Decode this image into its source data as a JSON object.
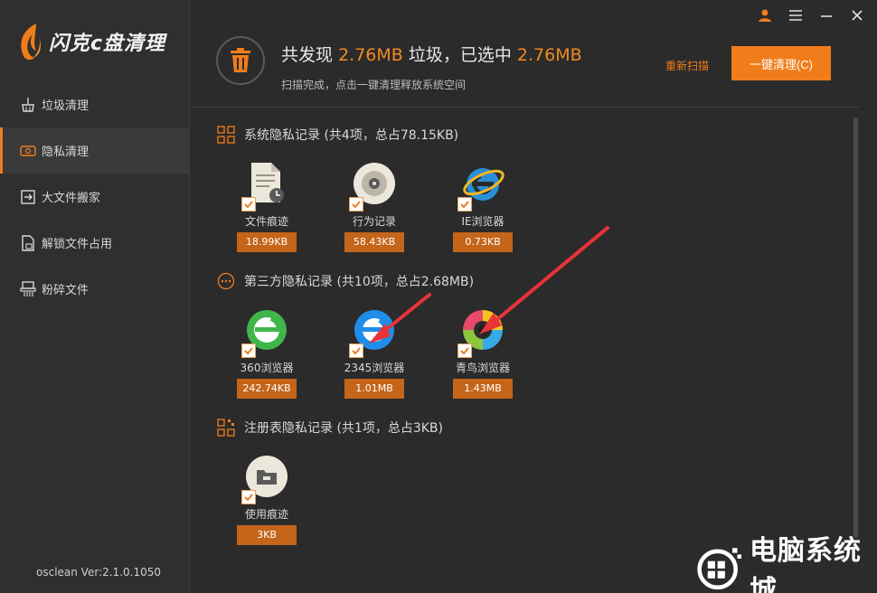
{
  "app": {
    "brand": "闪克c盘清理",
    "version": "osclean Ver:2.1.0.1050"
  },
  "sidebar": {
    "items": [
      {
        "label": "垃圾清理",
        "icon": "broom-icon",
        "active": false
      },
      {
        "label": "隐私清理",
        "icon": "privacy-icon",
        "active": true
      },
      {
        "label": "大文件搬家",
        "icon": "move-icon",
        "active": false
      },
      {
        "label": "解锁文件占用",
        "icon": "unlock-file-icon",
        "active": false
      },
      {
        "label": "粉碎文件",
        "icon": "shredder-icon",
        "active": false
      }
    ]
  },
  "header": {
    "summary_prefix": "共发现",
    "found_size": "2.76MB",
    "summary_mid": "垃圾，已选中",
    "selected_size": "2.76MB",
    "subtitle": "扫描完成，点击一键清理释放系统空间",
    "rescan_label": "重新扫描",
    "clean_label": "一键清理(C)"
  },
  "sections": [
    {
      "title": "系统隐私记录 (共4项，总占78.15KB)",
      "items": [
        {
          "label": "文件痕迹",
          "size": "18.99KB",
          "icon": "file-trace-icon"
        },
        {
          "label": "行为记录",
          "size": "58.43KB",
          "icon": "disc-record-icon"
        },
        {
          "label": "IE浏览器",
          "size": "0.73KB",
          "icon": "ie-browser-icon"
        }
      ]
    },
    {
      "title": "第三方隐私记录 (共10项，总占2.68MB)",
      "items": [
        {
          "label": "360浏览器",
          "size": "242.74KB",
          "icon": "360-browser-icon"
        },
        {
          "label": "2345浏览器",
          "size": "1.01MB",
          "icon": "2345-browser-icon"
        },
        {
          "label": "青鸟浏览器",
          "size": "1.43MB",
          "icon": "qingniao-browser-icon"
        }
      ]
    },
    {
      "title": "注册表隐私记录 (共1项，总占3KB)",
      "items": [
        {
          "label": "使用痕迹",
          "size": "3KB",
          "icon": "usage-trace-icon"
        }
      ]
    }
  ],
  "colors": {
    "accent": "#f07d1a",
    "size_badge": "#c4651a",
    "background": "#2b2b2b",
    "sidebar": "#2f2f2f"
  },
  "watermark": {
    "text": "电脑系统城"
  }
}
